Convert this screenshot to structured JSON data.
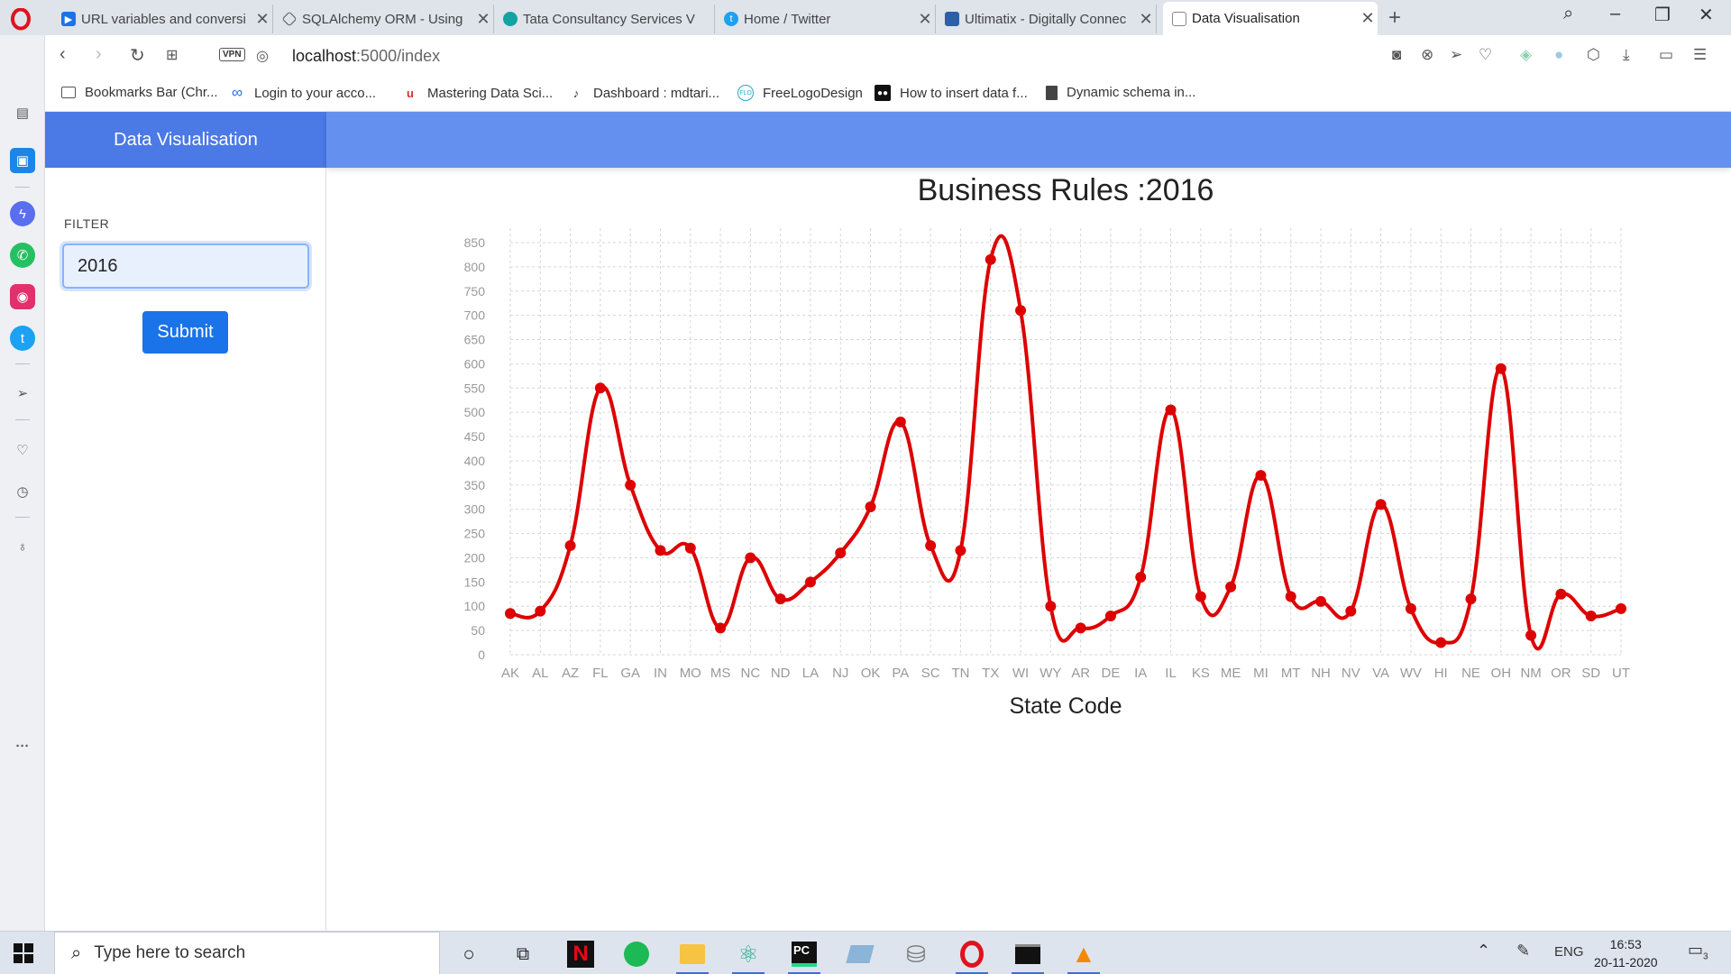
{
  "browser": {
    "tabs": [
      {
        "title": "URL variables and conversi",
        "icon": "youtube-icon",
        "color": "#1a73e8"
      },
      {
        "title": "SQLAlchemy ORM - Using",
        "icon": "sqlalchemy-icon",
        "color": "#555555"
      },
      {
        "title": "Tata Consultancy Services V",
        "icon": "tcs-icon",
        "color": "#12a3a3"
      },
      {
        "title": "Home / Twitter",
        "icon": "twitter-icon",
        "color": "#1da1f2"
      },
      {
        "title": "Ultimatix - Digitally Connec",
        "icon": "ultimatix-icon",
        "color": "#2c5fa8"
      },
      {
        "title": "Data Visualisation",
        "icon": "page-icon",
        "color": "#777777"
      }
    ],
    "url_host": "localhost",
    "url_path": ":5000/index",
    "vpn_label": "VPN",
    "bookmarks": [
      {
        "label": "Bookmarks Bar (Chr...",
        "icon": "folder-icon"
      },
      {
        "label": "Login to your acco...",
        "icon": "infinity-icon"
      },
      {
        "label": "Mastering Data Sci...",
        "icon": "udemy-icon"
      },
      {
        "label": "Dashboard : mdtari...",
        "icon": "dashboard-icon"
      },
      {
        "label": "FreeLogoDesign",
        "icon": "flo-icon"
      },
      {
        "label": "How to insert data f...",
        "icon": "medium-icon"
      },
      {
        "label": "Dynamic schema in...",
        "icon": "document-icon"
      }
    ]
  },
  "app": {
    "brand": "Data Visualisation",
    "filter_label": "FILTER",
    "filter_value": "2016",
    "submit_label": "Submit"
  },
  "chart_data": {
    "type": "line",
    "title": "Business Rules :2016",
    "xlabel": "State Code",
    "ylabel": "",
    "ylim": [
      0,
      850
    ],
    "ytick_step": 50,
    "grid": true,
    "line_color": "#dd0000",
    "categories": [
      "AK",
      "AL",
      "AZ",
      "FL",
      "GA",
      "IN",
      "MO",
      "MS",
      "NC",
      "ND",
      "LA",
      "NJ",
      "OK",
      "PA",
      "SC",
      "TN",
      "TX",
      "WI",
      "WY",
      "AR",
      "DE",
      "IA",
      "IL",
      "KS",
      "ME",
      "MI",
      "MT",
      "NH",
      "NV",
      "VA",
      "WV",
      "HI",
      "NE",
      "OH",
      "NM",
      "OR",
      "SD",
      "UT"
    ],
    "series": [
      {
        "values": [
          85,
          90,
          225,
          550,
          350,
          215,
          220,
          55,
          200,
          115,
          150,
          210,
          305,
          480,
          225,
          215,
          815,
          710,
          100,
          55,
          80,
          160,
          505,
          120,
          140,
          370,
          120,
          110,
          90,
          310,
          95,
          25,
          115,
          590,
          40,
          125,
          80,
          95
        ]
      }
    ]
  },
  "taskbar": {
    "search_placeholder": "Type here to search",
    "language": "ENG",
    "time": "16:53",
    "date": "20-11-2020",
    "notification_count": "3"
  }
}
